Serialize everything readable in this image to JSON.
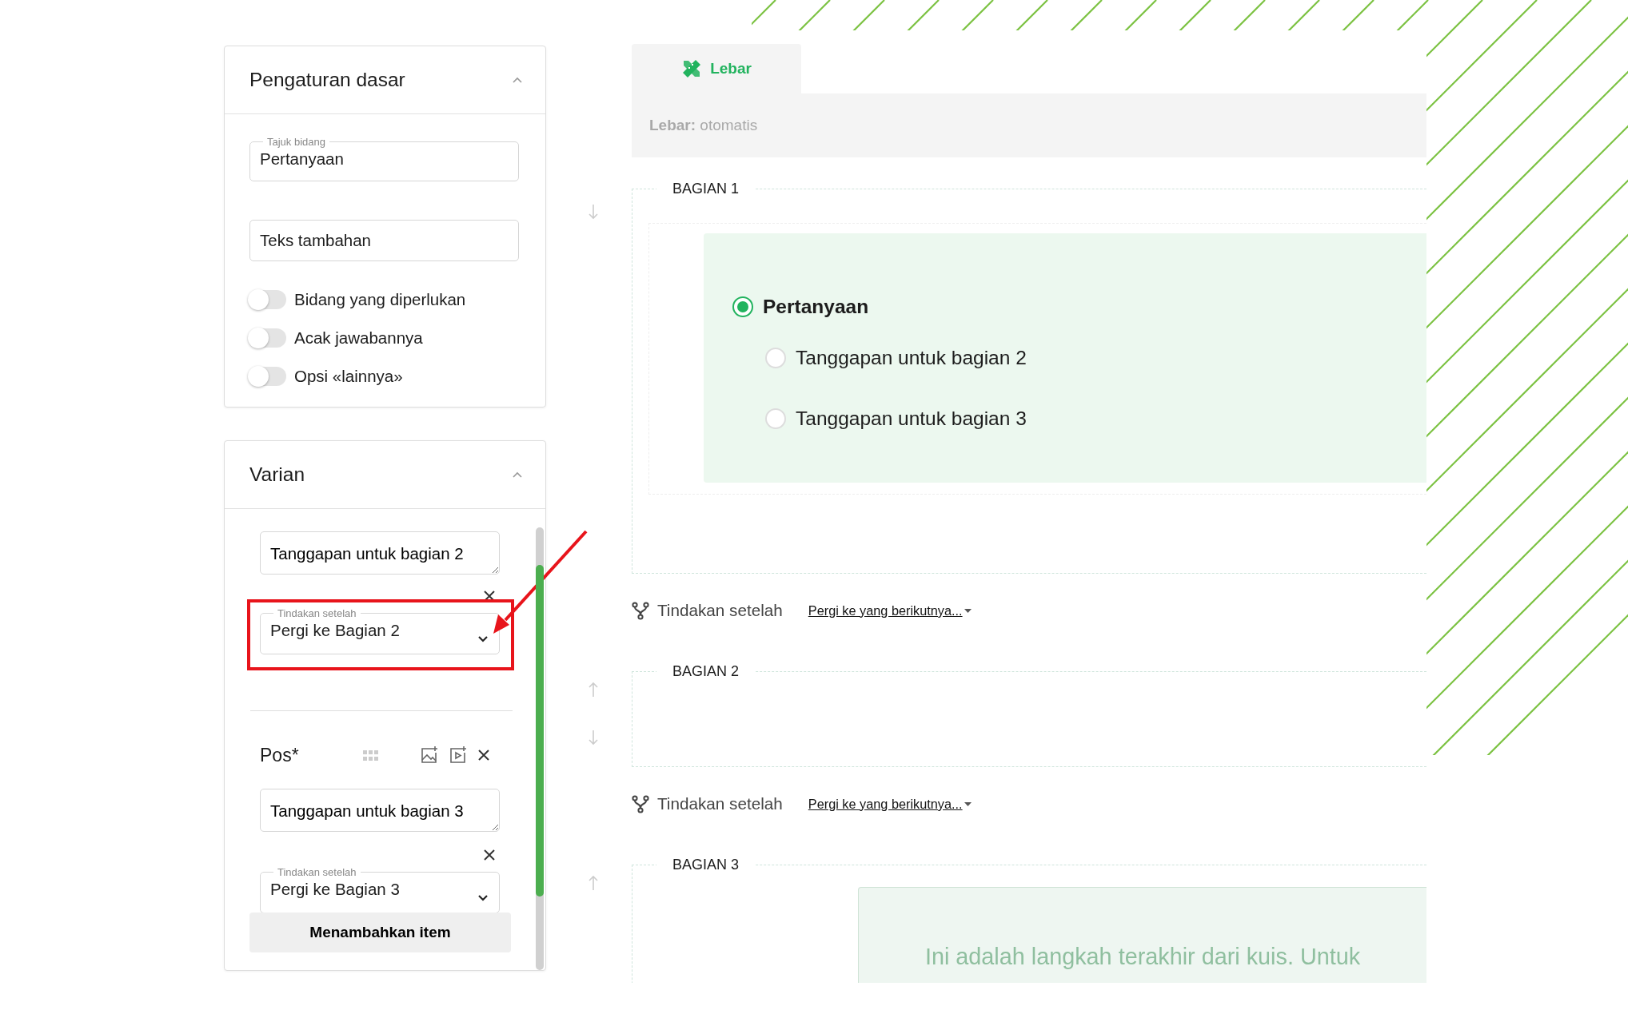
{
  "settings_panel": {
    "title": "Pengaturan dasar",
    "expanded": true,
    "fields": [
      {
        "label": "Tajuk bidang",
        "value": "Pertanyaan"
      },
      {
        "value": "Teks tambahan"
      }
    ],
    "toggles": [
      {
        "label": "Bidang yang diperlukan",
        "on": false
      },
      {
        "label": "Acak jawabannya",
        "on": false
      },
      {
        "label": "Opsi «lainnya»",
        "on": false
      }
    ]
  },
  "variants_panel": {
    "title": "Varian",
    "expanded": true,
    "variants": [
      {
        "answer": "Tanggapan untuk bagian 2",
        "action_label": "Tindakan setelah",
        "action_value": "Pergi ke Bagian 2",
        "highlighted": true
      },
      {
        "title": "Pos*",
        "answer": "Tanggapan untuk bagian 3",
        "action_label": "Tindakan setelah",
        "action_value": "Pergi ke Bagian 3",
        "highlighted": false
      }
    ],
    "add_button": "Menambahkan item"
  },
  "tabs": [
    {
      "label": "Lebar",
      "selected": true
    }
  ],
  "width_info": "**Lebar:** otomatis",
  "sections": [
    {
      "title": "BAGIAN 1",
      "question": {
        "label": "Pertanyaan",
        "selected": true,
        "options": [
          {
            "label": "Tanggapan untuk bagian 2",
            "selected": false
          },
          {
            "label": "Tanggapan untuk bagian 3",
            "selected": false
          }
        ]
      },
      "after": {
        "label": "Tindakan setelah",
        "value": "Pergi ke yang berikutnya..."
      }
    },
    {
      "title": "BAGIAN 2",
      "after": {
        "label": "Tindakan setelah",
        "value": "Pergi ke yang berikutnya..."
      }
    },
    {
      "title": "BAGIAN 3",
      "final_note": "Ini adalah langkah terakhir dari kuis. Untuk"
    }
  ]
}
